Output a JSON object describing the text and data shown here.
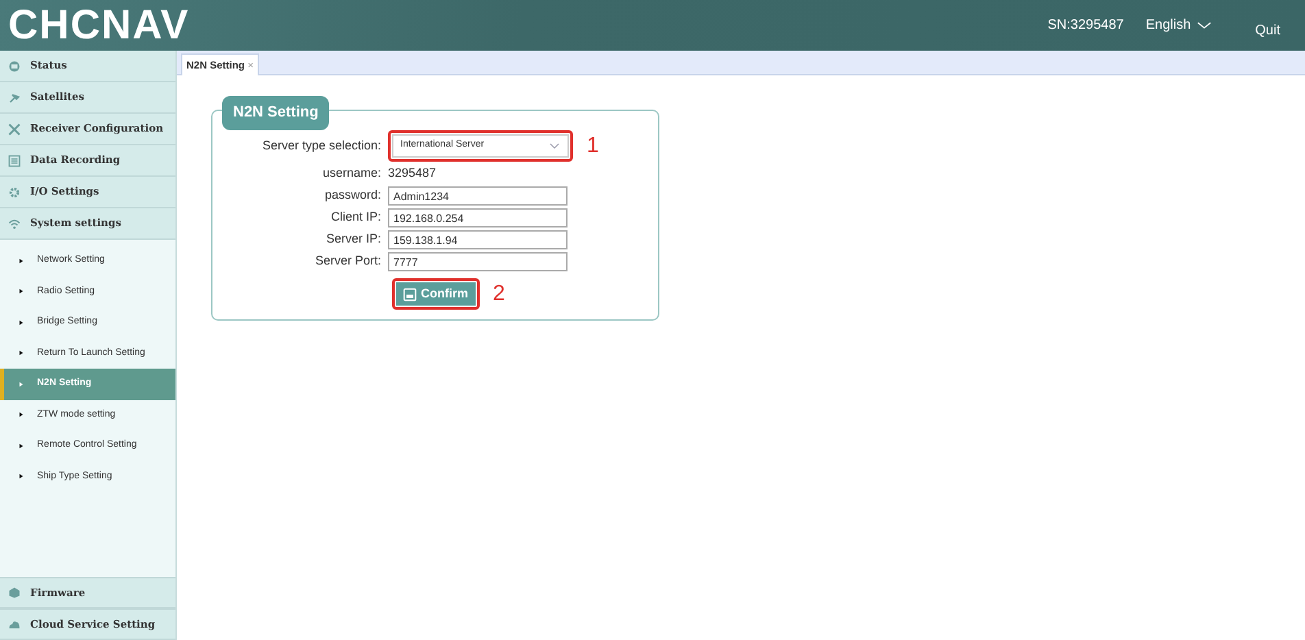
{
  "header": {
    "logo": "CHCNAV",
    "serial": "SN:3295487",
    "language": "English",
    "quit": "Quit"
  },
  "sidebar": {
    "items": [
      {
        "label": "Status",
        "expanded": false
      },
      {
        "label": "Satellites",
        "expanded": false
      },
      {
        "label": "Receiver Configuration",
        "expanded": false
      },
      {
        "label": "Data Recording",
        "expanded": false
      },
      {
        "label": "I/O Settings",
        "expanded": false
      },
      {
        "label": "System settings",
        "expanded": true,
        "children": [
          {
            "label": "Network Setting",
            "selected": false
          },
          {
            "label": "Radio Setting",
            "selected": false
          },
          {
            "label": "Bridge Setting",
            "selected": false
          },
          {
            "label": "Return To Launch Setting",
            "selected": false
          },
          {
            "label": "N2N Setting",
            "selected": true
          },
          {
            "label": "ZTW mode setting",
            "selected": false
          },
          {
            "label": "Remote Control Setting",
            "selected": false
          },
          {
            "label": "Ship Type Setting",
            "selected": false
          }
        ]
      }
    ],
    "bottom_items": [
      {
        "label": "Firmware"
      },
      {
        "label": "Cloud Service Setting"
      }
    ]
  },
  "tabs": [
    {
      "label": "N2N Setting",
      "close": "×",
      "selected": true
    }
  ],
  "form": {
    "title": "N2N Setting",
    "fields": [
      {
        "kind": "select",
        "label": "Server type selection:",
        "value": "International Server",
        "annotation": "1"
      },
      {
        "kind": "text",
        "label": "username:",
        "value": "3295487"
      },
      {
        "kind": "input",
        "label": "password:",
        "value": "Admin1234"
      },
      {
        "kind": "input",
        "label": "Client IP:",
        "value": "192.168.0.254"
      },
      {
        "kind": "input",
        "label": "Server IP:",
        "value": "159.138.1.94"
      },
      {
        "kind": "input",
        "label": "Server Port:",
        "value": "7777"
      }
    ],
    "confirm": {
      "label": "Confirm",
      "annotation": "2"
    }
  }
}
